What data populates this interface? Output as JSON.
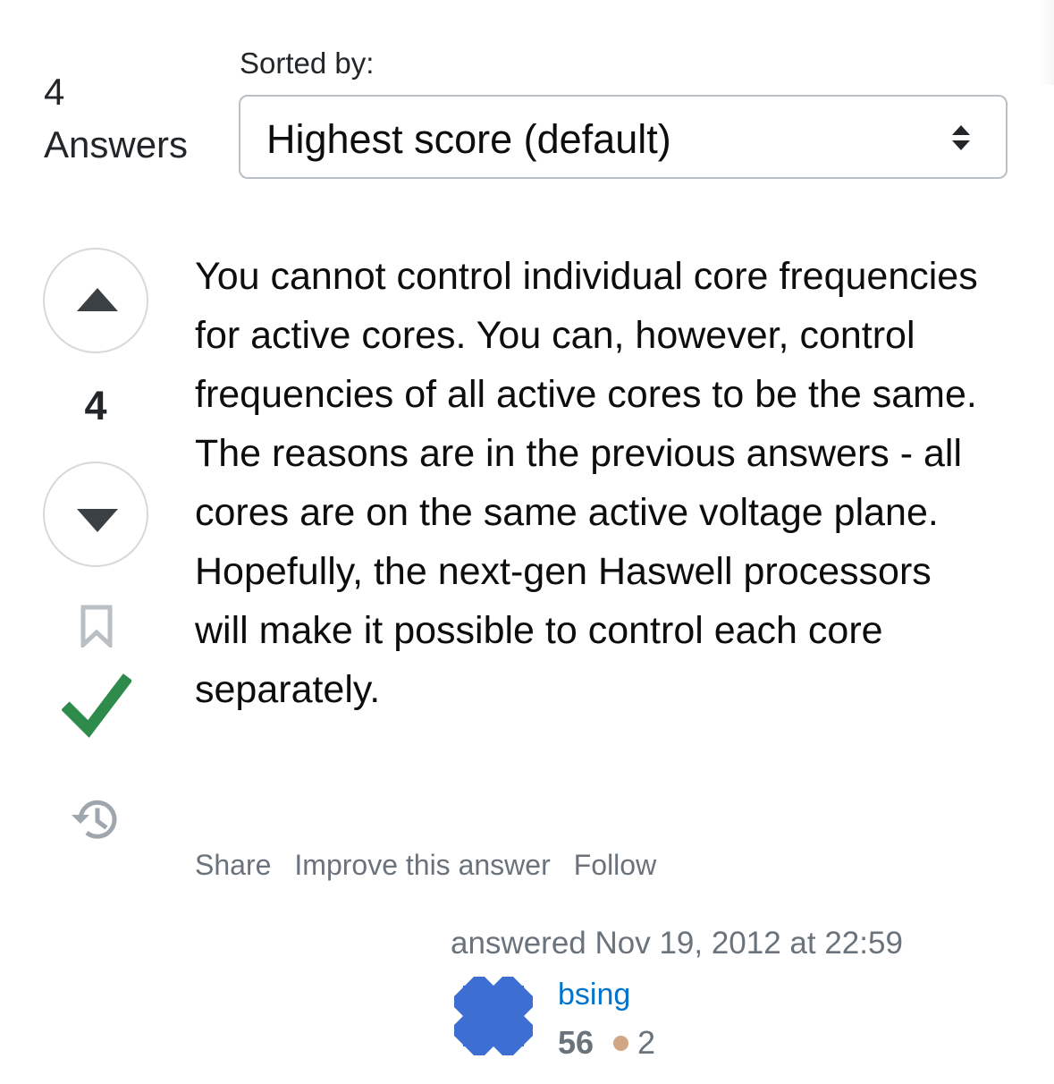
{
  "header": {
    "count": "4",
    "count_label": "Answers",
    "sort_label": "Sorted by:",
    "sort_value": "Highest score (default)"
  },
  "answer": {
    "score": "4",
    "accepted": true,
    "body": "You cannot control individual core frequencies for active cores. You can, however, control frequencies of all active cores to be the same. The reasons are in the previous answers - all cores are on the same active voltage plane. Hopefully, the next-gen Haswell processors will make it possible to control each core separately.",
    "menu": {
      "share": "Share",
      "improve": "Improve this answer",
      "follow": "Follow"
    },
    "signature": {
      "answered": "answered Nov 19, 2012 at 22:59",
      "username": "bsing",
      "reputation": "56",
      "bronze_badges": "2"
    }
  },
  "icons": {
    "upvote": "triangle-up-icon",
    "downvote": "triangle-down-icon",
    "bookmark": "bookmark-icon",
    "accepted": "checkmark-icon",
    "history": "history-icon",
    "select_arrows": "sort-arrows-icon",
    "avatar": "identicon"
  },
  "colors": {
    "accepted": "#2f8b4b",
    "link": "#0074cc",
    "muted": "#6a737c",
    "bronze": "#d1a684",
    "avatar": "#3c6fd1"
  }
}
